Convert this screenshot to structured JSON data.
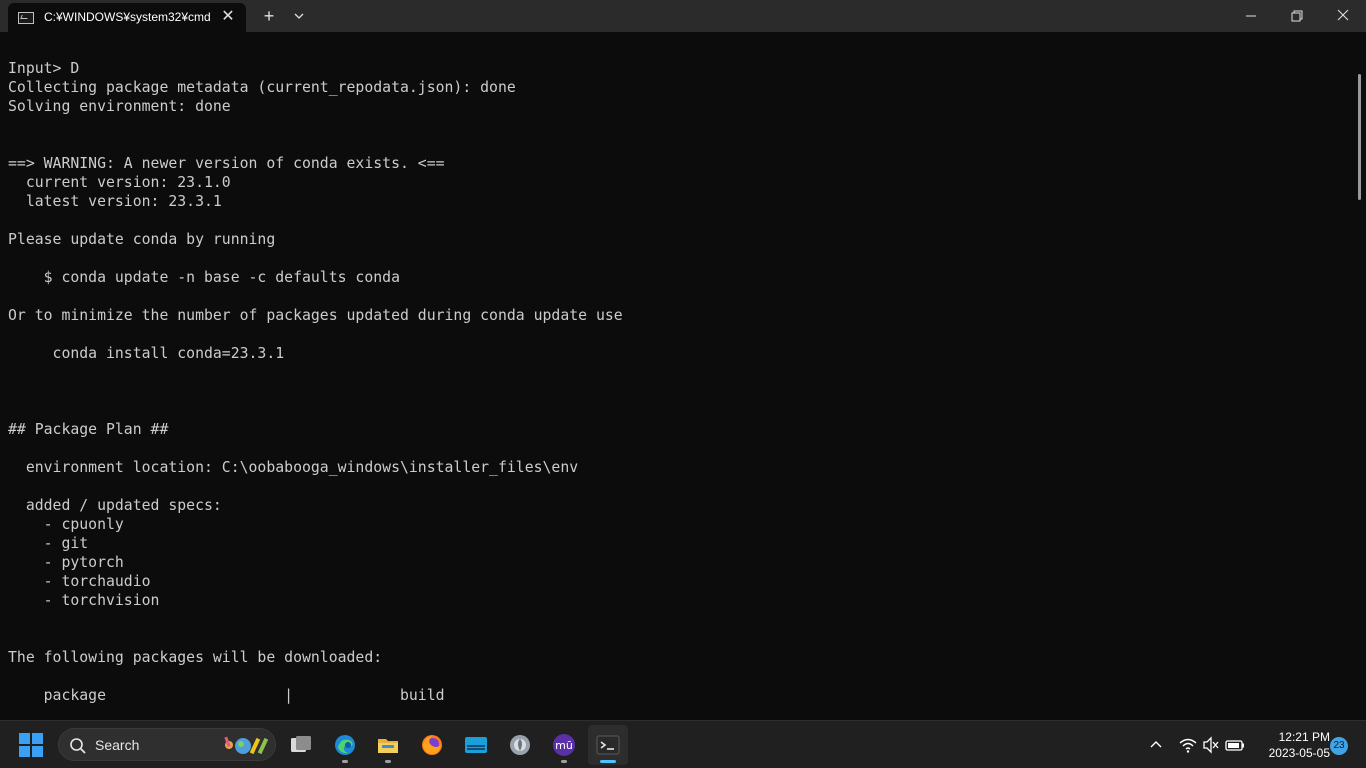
{
  "window": {
    "tab_title": "C:¥WINDOWS¥system32¥cmd",
    "tab_icon": "cmd-icon",
    "new_tab_label": "+",
    "close_tab_label": "✕",
    "controls": [
      "minimize-icon",
      "restore-icon",
      "close-icon"
    ]
  },
  "console": {
    "lines": [
      "Input> D",
      "Collecting package metadata (current_repodata.json): done",
      "Solving environment: done",
      "",
      "",
      "==> WARNING: A newer version of conda exists. <==",
      "  current version: 23.1.0",
      "  latest version: 23.3.1",
      "",
      "Please update conda by running",
      "",
      "    $ conda update -n base -c defaults conda",
      "",
      "Or to minimize the number of packages updated during conda update use",
      "",
      "     conda install conda=23.3.1",
      "",
      "",
      "",
      "## Package Plan ##",
      "",
      "  environment location: C:\\oobabooga_windows\\installer_files\\env",
      "",
      "  added / updated specs:",
      "    - cpuonly",
      "    - git",
      "    - pytorch",
      "    - torchaudio",
      "    - torchvision",
      "",
      "",
      "The following packages will be downloaded:",
      "",
      "    package                    |            build"
    ]
  },
  "taskbar": {
    "search_label": "Search",
    "apps": [
      {
        "name": "task-view-icon",
        "active": false,
        "running": false
      },
      {
        "name": "edge-icon",
        "active": false,
        "running": true
      },
      {
        "name": "file-explorer-icon",
        "active": false,
        "running": true
      },
      {
        "name": "firefox-icon",
        "active": false,
        "running": false
      },
      {
        "name": "screen-app-icon",
        "active": false,
        "running": false
      },
      {
        "name": "app-icon",
        "active": false,
        "running": false
      },
      {
        "name": "mu-app-icon",
        "active": false,
        "running": true
      },
      {
        "name": "terminal-icon",
        "active": true,
        "running": true
      }
    ],
    "time": "12:21 PM",
    "date": "2023-05-05",
    "notification_count": "23"
  },
  "colors": {
    "console_bg": "#0c0c0c",
    "console_text": "#cccccc",
    "titlebar_bg": "#2b2b2b",
    "taskbar_bg": "#202020",
    "accent": "#4cc2ff"
  }
}
